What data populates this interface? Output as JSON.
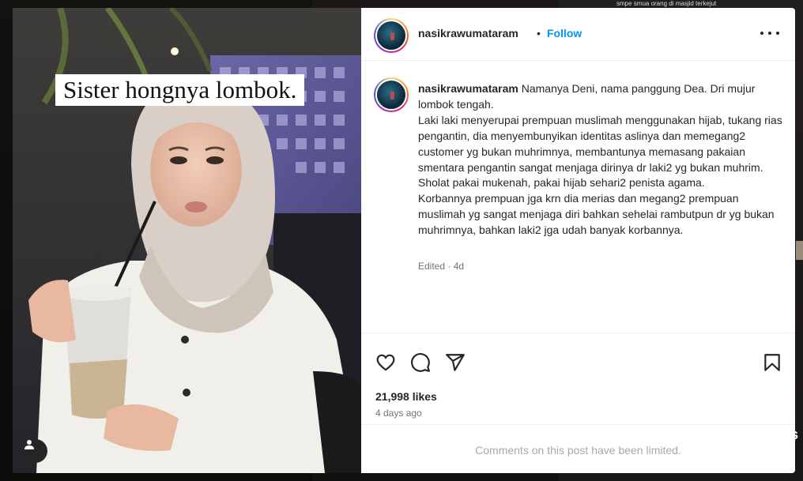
{
  "background": {
    "caption_snippet": "smpe smua orang di masjid terkejut",
    "arrow_text": "s"
  },
  "post": {
    "overlay_text": "Sister hongnya lombok.",
    "username": "nasikrawumataram",
    "separator": "•",
    "follow_label": "Follow",
    "caption_lines": [
      "Namanya Deni, nama panggung Dea. Dri mujur lombok tengah.",
      "Laki laki menyerupai prempuan muslimah menggunakan hijab, tukang rias pengantin, dia menyembunyikan identitas aslinya dan memegang2 customer yg bukan muhrimnya, membantunya memasang pakaian smentara pengantin sangat menjaga dirinya dr laki2 yg bukan muhrim.",
      "Sholat pakai mukenah, pakai hijab sehari2 penista agama.",
      "Korbannya prempuan jga krn dia merias dan megang2 prempuan muslimah yg sangat menjaga diri bahkan sehelai rambutpun dr yg bukan muhrimnya, bahkan laki2 jga udah banyak korbannya."
    ],
    "edited_meta": "Edited · 4d",
    "likes": "21,998 likes",
    "time_ago": "4 days ago",
    "comments_limited": "Comments on this post have been limited."
  },
  "icons": {
    "like": "heart-icon",
    "comment": "comment-icon",
    "share": "send-icon",
    "save": "bookmark-icon",
    "more": "more-options-icon",
    "tag": "user-tag-icon"
  },
  "colors": {
    "accent": "#0095f6",
    "text": "#262626",
    "muted": "#737373",
    "disabled": "#a8a8a8"
  }
}
